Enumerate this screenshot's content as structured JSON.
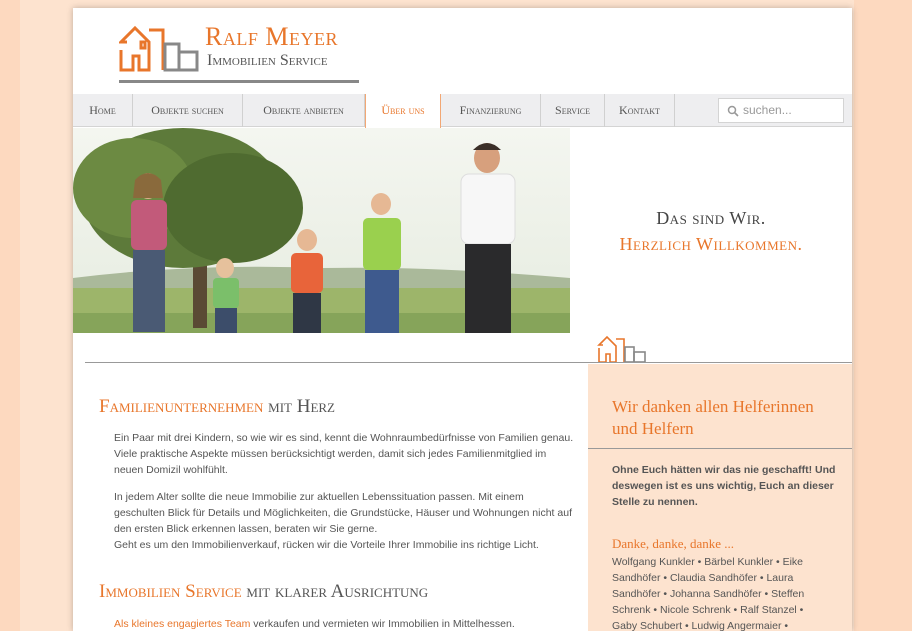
{
  "brand": {
    "name": "Ralf Meyer",
    "subtitle": "Immobilien Service"
  },
  "nav": {
    "items": [
      {
        "label": "Home"
      },
      {
        "label": "Objekte suchen"
      },
      {
        "label": "Objekte anbieten"
      },
      {
        "label": "Über uns"
      },
      {
        "label": "Finanzierung"
      },
      {
        "label": "Service"
      },
      {
        "label": "Kontakt"
      }
    ],
    "active": "Über uns",
    "search_placeholder": "suchen..."
  },
  "hero": {
    "line1": "Das sind Wir.",
    "line2": "Herzlich Willkommen."
  },
  "main": {
    "section1": {
      "title_accent": "Familienunternehmen",
      "title_rest": "mit Herz",
      "p1": "Ein Paar mit drei Kindern, so wie wir es sind, kennt die Wohnraumbedürfnisse von Familien genau. Viele praktische Aspekte müssen berücksichtigt werden, damit sich jedes Familienmitglied im neuen Domizil wohlfühlt.",
      "p2": "In jedem Alter sollte die neue Immobilie zur aktuellen Lebenssituation passen. Mit einem geschulten Blick für Details und Möglichkeiten, die Grundstücke, Häuser und Wohnungen nicht auf den ersten Blick erkennen lassen, beraten wir Sie gerne.",
      "p3": "Geht es um den Immobilienverkauf, rücken wir die Vorteile Ihrer Immobilie ins richtige Licht."
    },
    "section2": {
      "title_accent": "Immobilien Service",
      "title_rest": "mit klarer Ausrichtung",
      "link": "Als kleines engagiertes Team",
      "p1_rest": " verkaufen und vermieten wir Immobilien in Mittelhessen."
    }
  },
  "sidebar": {
    "title": "Wir danken allen Helferinnen und Helfern",
    "intro": "Ohne Euch hätten wir das nie geschafft! Und deswegen ist es uns wichtig, Euch an dieser Stelle zu nennen.",
    "subtitle": "Danke, danke, danke ...",
    "names": "Wolfgang Kunkler • Bärbel Kunkler • Eike Sandhöfer • Claudia Sandhöfer • Laura Sandhöfer • Johanna Sandhöfer • Steffen Schrenk • Nicole Schrenk • Ralf Stanzel • Gaby Schubert • Ludwig Angermaier •"
  },
  "colors": {
    "accent": "#e8762b",
    "background": "#fde3cf",
    "nav_bg": "#eeeef0",
    "text": "#555555"
  },
  "icons": {
    "logo": "house-logo-icon",
    "search": "search-icon",
    "small_logo": "small-house-icon"
  }
}
